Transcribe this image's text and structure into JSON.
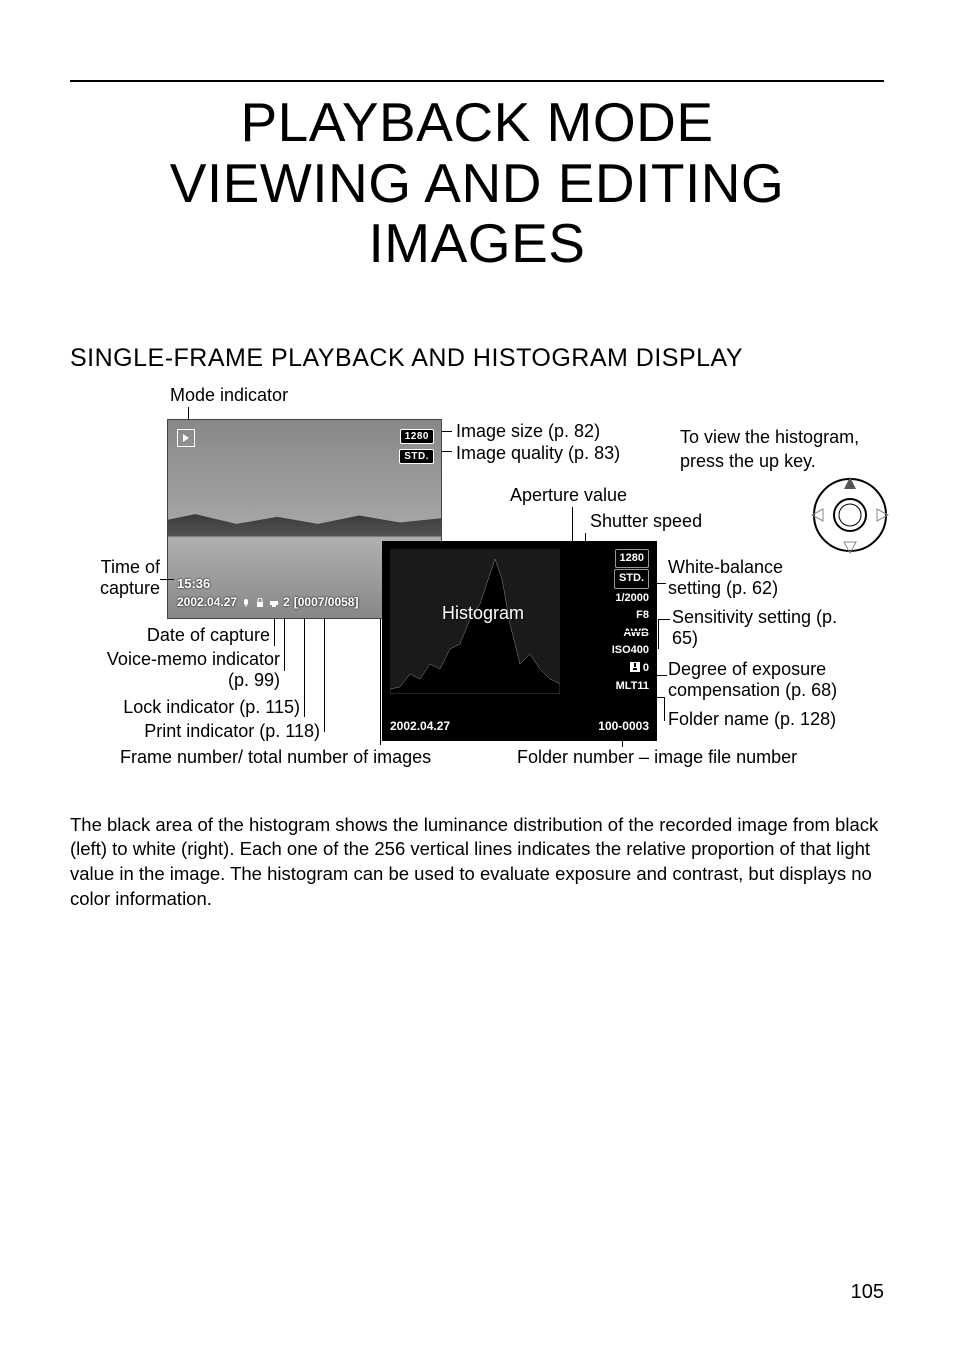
{
  "title_line1": "PLAYBACK MODE",
  "title_line2": "VIEWING AND EDITING IMAGES",
  "section_heading": "SINGLE-FRAME PLAYBACK AND HISTOGRAM DISPLAY",
  "labels": {
    "mode_indicator": "Mode indicator",
    "image_size": "Image size (p. 82)",
    "image_quality": "Image quality (p. 83)",
    "aperture_value": "Aperture value",
    "shutter_speed": "Shutter speed",
    "histogram_note": "To view the histogram, press the up key.",
    "time_of_capture": "Time of capture",
    "date_of_capture": "Date of capture",
    "voice_memo": "Voice-memo indicator (p. 99)",
    "lock_indicator": "Lock indicator (p. 115)",
    "print_indicator": "Print indicator (p. 118)",
    "frame_number": "Frame number/ total number of images",
    "histogram": "Histogram",
    "white_balance": "White-balance setting (p. 62)",
    "sensitivity": "Sensitivity setting (p. 65)",
    "exposure_comp": "Degree of exposure compensation (p. 68)",
    "folder_name": "Folder name (p. 128)",
    "folder_image_number": "Folder number – image file number"
  },
  "screen1": {
    "size_badge": "1280",
    "quality_badge": "STD.",
    "time": "15:36",
    "date": "2002.04.27",
    "print_count": "2",
    "frames": "[0007/0058]"
  },
  "screen2": {
    "size_badge": "1280",
    "quality_badge": "STD.",
    "shutter": "1/2000",
    "aperture": "F8",
    "wb": "AWB",
    "iso": "ISO400",
    "ev_icon": "0",
    "folder": "MLT11",
    "date": "2002.04.27",
    "file_no": "100-0003"
  },
  "body_paragraph": "The black area of the histogram shows the luminance distribution of the recorded image from black (left) to white (right). Each one of the 256 vertical lines indicates the relative proportion of that light value in the image. The histogram can be used to evaluate exposure and contrast, but displays no color information.",
  "page_number": "105"
}
